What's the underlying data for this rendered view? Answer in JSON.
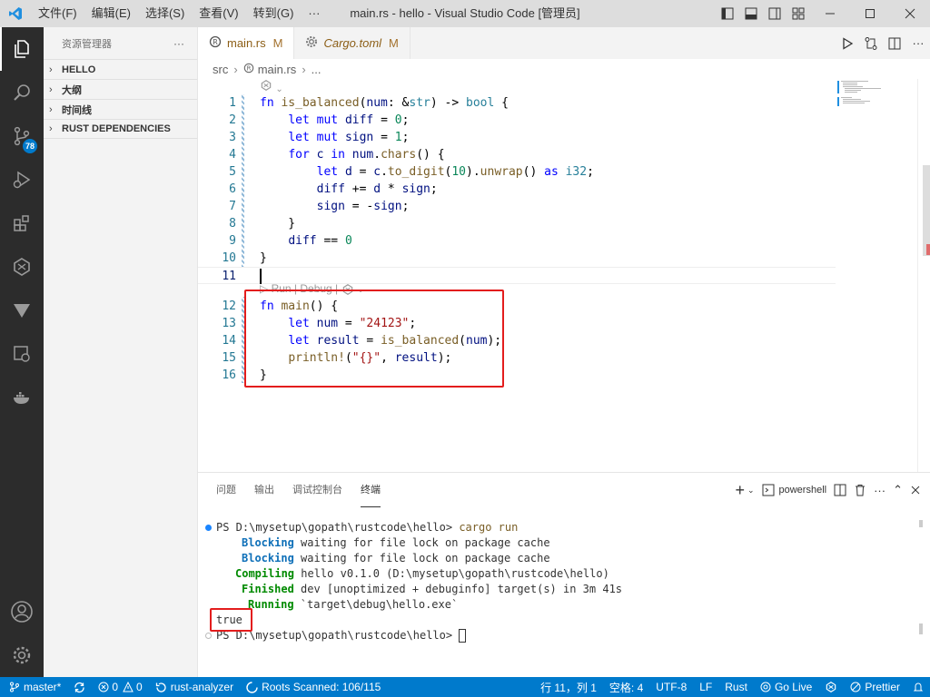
{
  "titlebar": {
    "menu": [
      "文件(F)",
      "编辑(E)",
      "选择(S)",
      "查看(V)",
      "转到(G)",
      "···"
    ],
    "window_title": "main.rs - hello - Visual Studio Code [管理员]"
  },
  "activity_bar": {
    "items": [
      "explorer",
      "search",
      "source-control",
      "run-debug",
      "extensions",
      "rust",
      "testing",
      "remote",
      "docker"
    ],
    "scm_badge": "78"
  },
  "sidebar": {
    "title": "资源管理器",
    "more": "···",
    "sections": [
      "HELLO",
      "大纲",
      "时间线",
      "RUST DEPENDENCIES"
    ]
  },
  "tabs": [
    {
      "label": "main.rs",
      "modified": "M",
      "active": true
    },
    {
      "label": "Cargo.toml",
      "modified": "M",
      "active": false
    }
  ],
  "breadcrumb": {
    "folder": "src",
    "file": "main.rs",
    "more": "..."
  },
  "editor": {
    "codelens_top": "",
    "codelens_main": "▷ Run | Debug | ",
    "lines": [
      {
        "n": "1",
        "text": "fn is_balanced(num: &str) -> bool {"
      },
      {
        "n": "2",
        "text": "    let mut diff = 0;"
      },
      {
        "n": "3",
        "text": "    let mut sign = 1;"
      },
      {
        "n": "4",
        "text": "    for c in num.chars() {"
      },
      {
        "n": "5",
        "text": "        let d = c.to_digit(10).unwrap() as i32;"
      },
      {
        "n": "6",
        "text": "        diff += d * sign;"
      },
      {
        "n": "7",
        "text": "        sign = -sign;"
      },
      {
        "n": "8",
        "text": "    }"
      },
      {
        "n": "9",
        "text": "    diff == 0"
      },
      {
        "n": "10",
        "text": "}"
      },
      {
        "n": "11",
        "text": ""
      },
      {
        "n": "12",
        "text": "fn main() {"
      },
      {
        "n": "13",
        "text": "    let num = \"24123\";"
      },
      {
        "n": "14",
        "text": "    let result = is_balanced(num);"
      },
      {
        "n": "15",
        "text": "    println!(\"{}\", result);"
      },
      {
        "n": "16",
        "text": "}"
      }
    ]
  },
  "panel": {
    "tabs": [
      "问题",
      "输出",
      "调试控制台",
      "终端"
    ],
    "active_tab": "终端",
    "shell": "powershell",
    "terminal_lines": [
      {
        "prefix": "PS D:\\mysetup\\gopath\\rustcode\\hello> ",
        "cmd": "cargo run",
        "rest": ""
      },
      {
        "label": "Blocking",
        "rest": " waiting for file lock on package cache"
      },
      {
        "label": "Blocking",
        "rest": " waiting for file lock on package cache"
      },
      {
        "label": "Compiling",
        "rest": " hello v0.1.0 (D:\\mysetup\\gopath\\rustcode\\hello)"
      },
      {
        "label": "Finished",
        "rest": " dev [unoptimized + debuginfo] target(s) in 3m 41s"
      },
      {
        "label": "Running",
        "rest": " `target\\debug\\hello.exe`"
      },
      {
        "output": "true"
      },
      {
        "prompt": "PS D:\\mysetup\\gopath\\rustcode\\hello> "
      }
    ]
  },
  "statusbar": {
    "branch": "master*",
    "sync": "",
    "errors": "0",
    "warnings": "0",
    "analyzer": "rust-analyzer",
    "roots": "Roots Scanned: 106/115",
    "position": "行 11，列 1",
    "spaces": "空格: 4",
    "encoding": "UTF-8",
    "eol": "LF",
    "language": "Rust",
    "golive": "Go Live",
    "prettier": "Prettier"
  },
  "colors": {
    "accent": "#007acc",
    "highlight_box": "#e31d1d",
    "activity_bar": "#2c2c2c"
  }
}
